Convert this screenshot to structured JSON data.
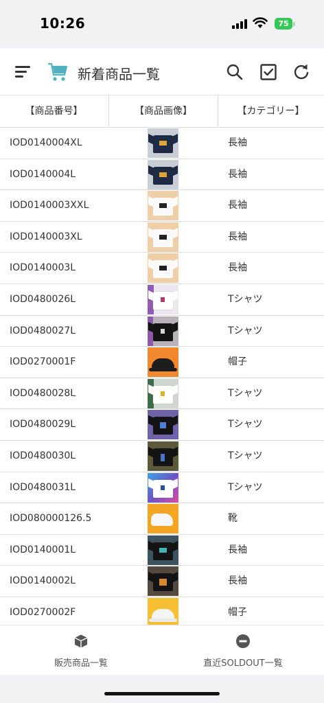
{
  "status_bar": {
    "time": "10:26",
    "battery": "75"
  },
  "header": {
    "title": "新着商品一覧"
  },
  "table": {
    "columns": [
      "【商品番号】",
      "【商品画像】",
      "【カテゴリー】"
    ],
    "rows": [
      {
        "code": "IOD0140004XL",
        "category": "長袖"
      },
      {
        "code": "IOD0140004L",
        "category": "長袖"
      },
      {
        "code": "IOD0140003XXL",
        "category": "長袖"
      },
      {
        "code": "IOD0140003XL",
        "category": "長袖"
      },
      {
        "code": "IOD0140003L",
        "category": "長袖"
      },
      {
        "code": "IOD0480026L",
        "category": "Tシャツ"
      },
      {
        "code": "IOD0480027L",
        "category": "Tシャツ"
      },
      {
        "code": "IOD0270001F",
        "category": "帽子"
      },
      {
        "code": "IOD0480028L",
        "category": "Tシャツ"
      },
      {
        "code": "IOD0480029L",
        "category": "Tシャツ"
      },
      {
        "code": "IOD0480030L",
        "category": "Tシャツ"
      },
      {
        "code": "IOD0480031L",
        "category": "Tシャツ"
      },
      {
        "code": "IOD080000126.5",
        "category": "靴"
      },
      {
        "code": "IOD0140001L",
        "category": "長袖"
      },
      {
        "code": "IOD0140002L",
        "category": "長袖"
      },
      {
        "code": "IOD0270002F",
        "category": "帽子"
      }
    ]
  },
  "tabs": [
    {
      "label": "販売商品一覧",
      "icon": "box-icon"
    },
    {
      "label": "直近SOLDOUT一覧",
      "icon": "minus-circle-icon"
    }
  ],
  "colors": {
    "accent": "#4fb3bf",
    "battery": "#34c759"
  }
}
